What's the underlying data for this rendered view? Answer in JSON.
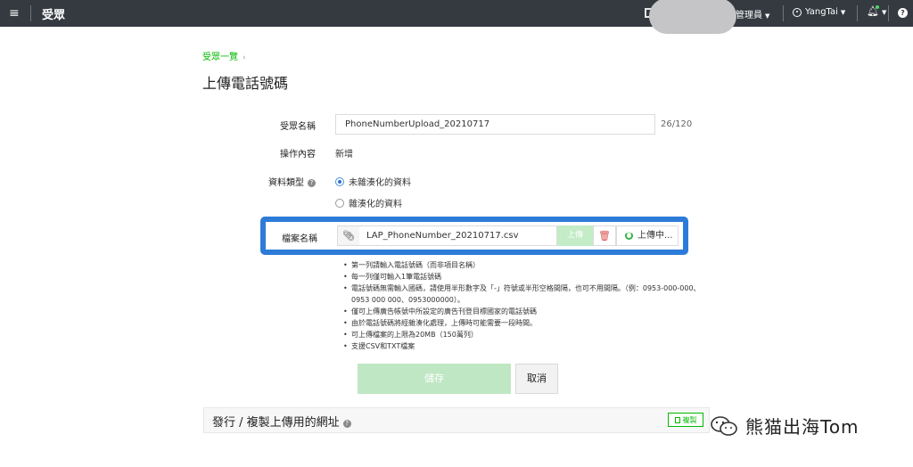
{
  "topbar": {
    "menu_icon": "hamburger-icon",
    "app_title": "受眾",
    "role_label": "管理員",
    "user_name": "YangTai",
    "icons": [
      "document-icon",
      "user-icon",
      "bell-icon",
      "help-icon"
    ],
    "help_glyph": "?",
    "notification_color": "#4cd964"
  },
  "breadcrumb": {
    "label": "受眾一覽",
    "arrow": "›"
  },
  "page": {
    "title": "上傳電話號碼"
  },
  "form": {
    "name_label": "受眾名稱",
    "name_value": "PhoneNumberUpload_20210717",
    "name_counter": "26/120",
    "operation_label": "操作內容",
    "operation_value": "新增",
    "data_type_label": "資料類型",
    "data_type_info": "?",
    "data_type_options": [
      {
        "label": "未雜湊化的資料",
        "selected": true
      },
      {
        "label": "雜湊化的資料",
        "selected": false
      }
    ],
    "file_label": "檔案名稱",
    "file_name": "LAP_PhoneNumber_20210717.csv",
    "upload_button": "上傳",
    "file_status": "上傳中..."
  },
  "notes": [
    "第一列請輸入電話號碼（而非項目名稱）",
    "每一列僅可輸入1筆電話號碼",
    "電話號碼無需輸入國碼，請使用半形數字及「-」符號或半形空格間隔，也可不用間隔。（例：0953-000-000、0953 000 000、0953000000）。",
    "僅可上傳廣告帳號中所設定的廣告刊登目標國家的電話號碼",
    "由於電話號碼將經雜湊化處理，上傳時可能需要一段時間。",
    "可上傳檔案的上限為20MB（150萬列）",
    "支援CSV和TXT檔案"
  ],
  "actions": {
    "save": "儲存",
    "cancel": "取消"
  },
  "publish_section": {
    "title": "發行 / 複製上傳用的網址",
    "info": "?",
    "copy_button": "複製"
  },
  "watermark": {
    "text": "熊猫出海Tom"
  },
  "colors": {
    "brand_green": "#00b900",
    "highlight_blue": "#2d7bd8",
    "topbar": "#343a40"
  }
}
